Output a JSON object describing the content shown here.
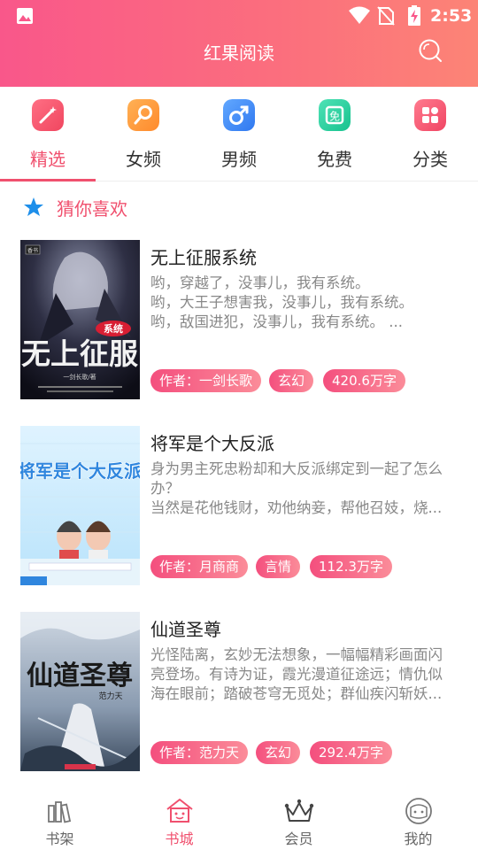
{
  "status_bar": {
    "time": "2:53"
  },
  "app_bar": {
    "title": "红果阅读"
  },
  "colors": {
    "accent": "#f0506e",
    "header_gradient_start": "#f9578a",
    "header_gradient_end": "#fc8476"
  },
  "tabs": [
    {
      "label": "精选",
      "icon": "magic-wand-icon",
      "active": true
    },
    {
      "label": "女频",
      "icon": "female-icon",
      "active": false
    },
    {
      "label": "男频",
      "icon": "male-icon",
      "active": false
    },
    {
      "label": "免费",
      "icon": "free-icon",
      "active": false
    },
    {
      "label": "分类",
      "icon": "category-grid-icon",
      "active": false
    }
  ],
  "section": {
    "title": "猜你喜欢"
  },
  "books": [
    {
      "title": "无上征服系统",
      "desc": [
        "哟，穿越了，没事儿，我有系统。",
        "  哟，大王子想害我，没事儿，我有系统。",
        "  哟，敌国进犯，没事儿，我有系统。 ..."
      ],
      "author": "作者：一剑长歌",
      "genre": "玄幻",
      "count": "420.6万字",
      "cover": {
        "title": "无上征服",
        "badge": "系统",
        "author": "一剑长歌/著"
      }
    },
    {
      "title": "将军是个大反派",
      "desc": [
        "身为男主死忠粉却和大反派绑定到一起了怎么",
        "办？",
        "当然是花他钱财，劝他纳妾，帮他召妓，烧..."
      ],
      "author": "作者：月商商",
      "genre": "言情",
      "count": "112.3万字",
      "cover": {
        "title": "将军是个大反派"
      }
    },
    {
      "title": "仙道圣尊",
      "desc": [
        "光怪陆离，玄妙无法想象，一幅幅精彩画面闪",
        "亮登场。有诗为证，霞光漫道征途远；情仇似",
        "海在眼前；踏破苍穹无觅处；群仙疾闪斩妖..."
      ],
      "author": "作者：范力天",
      "genre": "玄幻",
      "count": "292.4万字",
      "cover": {
        "title": "仙道圣尊",
        "author": "范力天"
      }
    }
  ],
  "bottom_nav": [
    {
      "label": "书架",
      "icon": "bookshelf-icon",
      "active": false
    },
    {
      "label": "书城",
      "icon": "bookstore-house-icon",
      "active": true
    },
    {
      "label": "会员",
      "icon": "crown-icon",
      "active": false
    },
    {
      "label": "我的",
      "icon": "profile-face-icon",
      "active": false
    }
  ]
}
